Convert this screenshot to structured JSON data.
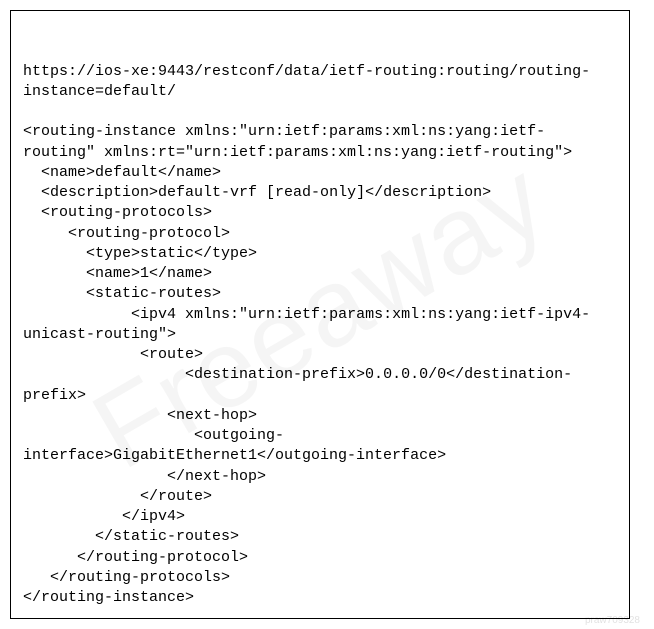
{
  "url": "https://ios-xe:9443/restconf/data/ietf-routing:routing/routing-instance=default/",
  "root_open": "<routing-instance xmlns:\"urn:ietf:params:xml:ns:yang:ietf-routing\" xmlns:rt=\"urn:ietf:params:xml:ns:yang:ietf-routing\">",
  "name_line": "  <name>default</name>",
  "description_line": "  <description>default-vrf [read-only]</description>",
  "routing_protocols_open": "  <routing-protocols>",
  "routing_protocol_open": "     <routing-protocol>",
  "type_line": "       <type>static</type>",
  "rp_name_line": "       <name>1</name>",
  "static_routes_open": "       <static-routes>",
  "ipv4_open": "            <ipv4 xmlns:\"urn:ietf:params:xml:ns:yang:ietf-ipv4-unicast-routing\">",
  "route_open": "             <route>",
  "dest_prefix": "                  <destination-prefix>0.0.0.0/0</destination-prefix>",
  "next_hop_open": "                <next-hop>",
  "outgoing_interface": "                   <outgoing-interface>GigabitEthernet1</outgoing-interface>",
  "next_hop_close": "                </next-hop>",
  "route_close": "             </route>",
  "ipv4_close": "           </ipv4>",
  "static_routes_close": "        </static-routes>",
  "routing_protocol_close": "      </routing-protocol>",
  "routing_protocols_close": "   </routing-protocols>",
  "root_close": "</routing-instance>",
  "watermark": "Freeaway",
  "footer_id": "praw709328"
}
